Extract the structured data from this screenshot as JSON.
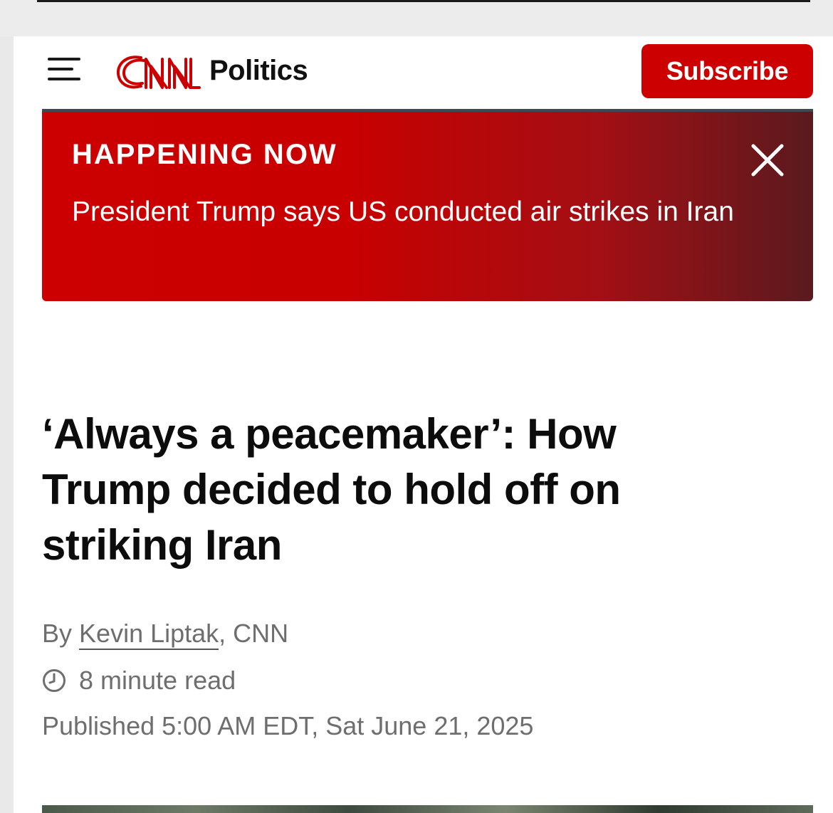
{
  "header": {
    "menu_icon": "hamburger-menu-icon",
    "logo_text": "CNN",
    "section": "Politics",
    "subscribe_label": "Subscribe"
  },
  "banner": {
    "label": "HAPPENING NOW",
    "headline": "President Trump says US conducted air strikes in Iran",
    "close_icon": "close-icon"
  },
  "article": {
    "headline": "‘Always a peacemaker’: How Trump decided to hold off on striking Iran",
    "byline_prefix": "By",
    "author": "Kevin Liptak",
    "byline_suffix": ", CNN",
    "read_time": "8 minute read",
    "published": "Published 5:00 AM EDT, Sat June 21, 2025",
    "clock_icon": "clock-icon"
  },
  "colors": {
    "brand_red": "#cc0000",
    "text_dark": "#0c0c0c",
    "meta_gray": "#6e6e6e"
  }
}
